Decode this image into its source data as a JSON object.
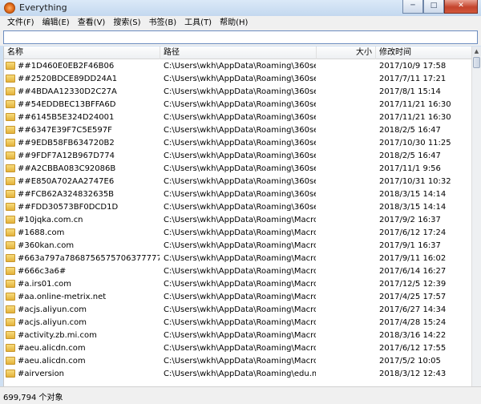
{
  "window": {
    "title": "Everything",
    "controls": {
      "minimize": "─",
      "maximize": "□",
      "close": "✕"
    }
  },
  "menu": [
    "文件(F)",
    "编辑(E)",
    "查看(V)",
    "搜索(S)",
    "书签(B)",
    "工具(T)",
    "帮助(H)"
  ],
  "search": {
    "value": "",
    "placeholder": ""
  },
  "columns": {
    "name": "名称",
    "path": "路径",
    "size": "大小",
    "modified": "修改时间"
  },
  "rows": [
    {
      "name": "##1D460E0EB2F46B06",
      "path": "C:\\Users\\wkh\\AppData\\Roaming\\360se6...",
      "modified": "2017/10/9 17:58"
    },
    {
      "name": "##2520BDCE89DD24A1",
      "path": "C:\\Users\\wkh\\AppData\\Roaming\\360se6...",
      "modified": "2017/7/11 17:21"
    },
    {
      "name": "##4BDAA12330D2C27A",
      "path": "C:\\Users\\wkh\\AppData\\Roaming\\360se6...",
      "modified": "2017/8/1 15:14"
    },
    {
      "name": "##54EDDBEC13BFFA6D",
      "path": "C:\\Users\\wkh\\AppData\\Roaming\\360se6...",
      "modified": "2017/11/21 16:30"
    },
    {
      "name": "##6145B5E324D24001",
      "path": "C:\\Users\\wkh\\AppData\\Roaming\\360se6...",
      "modified": "2017/11/21 16:30"
    },
    {
      "name": "##6347E39F7C5E597F",
      "path": "C:\\Users\\wkh\\AppData\\Roaming\\360se6...",
      "modified": "2018/2/5 16:47"
    },
    {
      "name": "##9EDB58FB634720B2",
      "path": "C:\\Users\\wkh\\AppData\\Roaming\\360se6...",
      "modified": "2017/10/30 11:25"
    },
    {
      "name": "##9FDF7A12B967D774",
      "path": "C:\\Users\\wkh\\AppData\\Roaming\\360se6...",
      "modified": "2018/2/5 16:47"
    },
    {
      "name": "##A2CBBA083C92086B",
      "path": "C:\\Users\\wkh\\AppData\\Roaming\\360se6...",
      "modified": "2017/11/1 9:56"
    },
    {
      "name": "##E850A702AA2747E6",
      "path": "C:\\Users\\wkh\\AppData\\Roaming\\360se6...",
      "modified": "2017/10/31 10:32"
    },
    {
      "name": "##FCB62A324832635B",
      "path": "C:\\Users\\wkh\\AppData\\Roaming\\360se6...",
      "modified": "2018/3/15 14:14"
    },
    {
      "name": "##FDD30573BF0DCD1D",
      "path": "C:\\Users\\wkh\\AppData\\Roaming\\360se6...",
      "modified": "2018/3/15 14:14"
    },
    {
      "name": "#10jqka.com.cn",
      "path": "C:\\Users\\wkh\\AppData\\Roaming\\Macro...",
      "modified": "2017/9/2 16:37"
    },
    {
      "name": "#1688.com",
      "path": "C:\\Users\\wkh\\AppData\\Roaming\\Macro...",
      "modified": "2017/6/12 17:24"
    },
    {
      "name": "#360kan.com",
      "path": "C:\\Users\\wkh\\AppData\\Roaming\\Macro...",
      "modified": "2017/9/1 16:37"
    },
    {
      "name": "#663a797a78687565757063777772...",
      "path": "C:\\Users\\wkh\\AppData\\Roaming\\Macro...",
      "modified": "2017/9/11 16:02"
    },
    {
      "name": "#666c3a6#",
      "path": "C:\\Users\\wkh\\AppData\\Roaming\\Macro...",
      "modified": "2017/6/14 16:27"
    },
    {
      "name": "#a.irs01.com",
      "path": "C:\\Users\\wkh\\AppData\\Roaming\\Macro...",
      "modified": "2017/12/5 12:39"
    },
    {
      "name": "#aa.online-metrix.net",
      "path": "C:\\Users\\wkh\\AppData\\Roaming\\Macro...",
      "modified": "2017/4/25 17:57"
    },
    {
      "name": "#acjs.aliyun.com",
      "path": "C:\\Users\\wkh\\AppData\\Roaming\\Macro...",
      "modified": "2017/6/27 14:34"
    },
    {
      "name": "#acjs.aliyun.com",
      "path": "C:\\Users\\wkh\\AppData\\Roaming\\Macro...",
      "modified": "2017/4/28 15:24"
    },
    {
      "name": "#activity.zb.mi.com",
      "path": "C:\\Users\\wkh\\AppData\\Roaming\\Macro...",
      "modified": "2018/3/16 14:22"
    },
    {
      "name": "#aeu.alicdn.com",
      "path": "C:\\Users\\wkh\\AppData\\Roaming\\Macro...",
      "modified": "2017/6/12 17:55"
    },
    {
      "name": "#aeu.alicdn.com",
      "path": "C:\\Users\\wkh\\AppData\\Roaming\\Macro...",
      "modified": "2017/5/2 10:05"
    },
    {
      "name": "#airversion",
      "path": "C:\\Users\\wkh\\AppData\\Roaming\\edu.me...",
      "modified": "2018/3/12 12:43"
    }
  ],
  "status": {
    "count_text": "699,794 个对象"
  }
}
